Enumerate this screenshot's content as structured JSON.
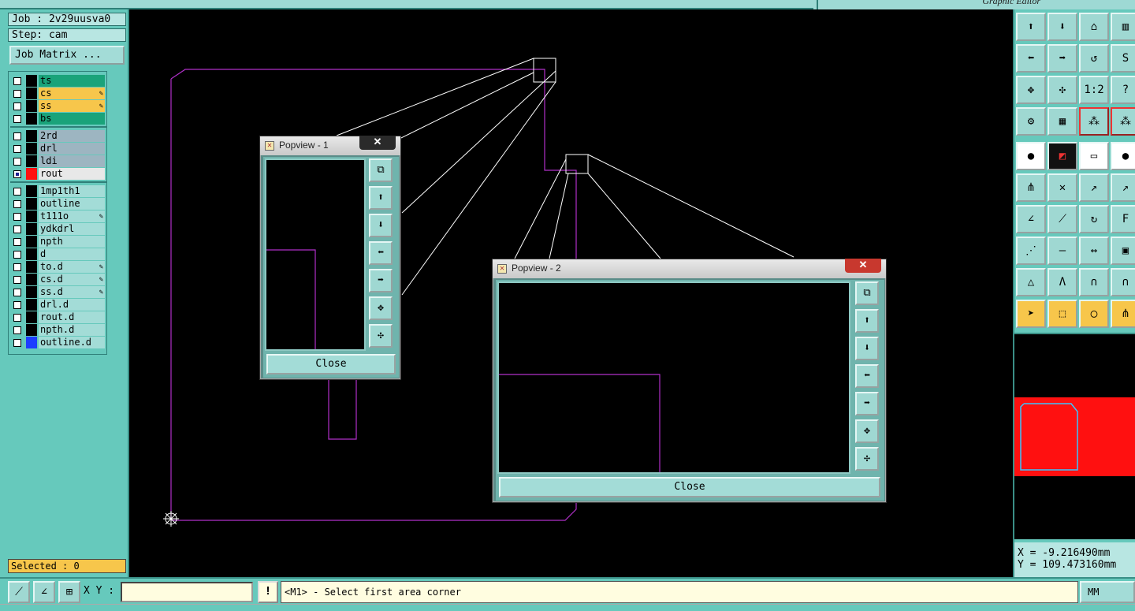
{
  "topbar": {
    "title": "Graphic Editor"
  },
  "job": {
    "job_label": "Job : 2v29uusva0",
    "step_label": "Step: cam",
    "matrix_button": "Job Matrix ..."
  },
  "layers": [
    {
      "name": "ts",
      "color": "#1aa37a",
      "marked": false
    },
    {
      "name": "cs",
      "color": "#f7c64b",
      "marked": true
    },
    {
      "name": "ss",
      "color": "#f7c64b",
      "marked": true
    },
    {
      "name": "bs",
      "color": "#1aa37a",
      "marked": false
    },
    {
      "name": "2rd",
      "color": "#9db5c1",
      "marked": false
    },
    {
      "name": "drl",
      "color": "#9db5c1",
      "marked": false
    },
    {
      "name": "ldi",
      "color": "#9db5c1",
      "marked": false
    },
    {
      "name": "rout",
      "color": "#e8e8e8",
      "marked": false,
      "active": true
    },
    {
      "name": "1mp1th1",
      "color": "#a3dcd7",
      "marked": false
    },
    {
      "name": "outline",
      "color": "#a3dcd7",
      "marked": false
    },
    {
      "name": "t111o",
      "color": "#a3dcd7",
      "marked": true
    },
    {
      "name": "ydkdrl",
      "color": "#a3dcd7",
      "marked": false
    },
    {
      "name": "npth",
      "color": "#a3dcd7",
      "marked": false
    },
    {
      "name": "d",
      "color": "#a3dcd7",
      "marked": false
    },
    {
      "name": "to.d",
      "color": "#a3dcd7",
      "marked": true
    },
    {
      "name": "cs.d",
      "color": "#a3dcd7",
      "marked": true
    },
    {
      "name": "ss.d",
      "color": "#a3dcd7",
      "marked": true
    },
    {
      "name": "drl.d",
      "color": "#a3dcd7",
      "marked": false
    },
    {
      "name": "rout.d",
      "color": "#a3dcd7",
      "marked": false
    },
    {
      "name": "npth.d",
      "color": "#a3dcd7",
      "marked": false
    },
    {
      "name": "outline.d",
      "color": "#a3dcd7",
      "marked": false,
      "swatch": "#1d3dff"
    }
  ],
  "selected": "Selected : 0",
  "popup1": {
    "title": "Popview - 1",
    "close_label": "Close"
  },
  "popup2": {
    "title": "Popview - 2",
    "close_label": "Close"
  },
  "coords": {
    "x": "X = -9.216490mm",
    "y": "Y = 109.473160mm"
  },
  "bottom": {
    "xy_label": "X Y :",
    "xy_value": "",
    "excl": "!",
    "prompt": "<M1> - Select first area corner",
    "units": "MM"
  },
  "colors": {
    "panel": "#66c9bc",
    "profile": "#b030c8",
    "accent_red": "#ff1010"
  }
}
